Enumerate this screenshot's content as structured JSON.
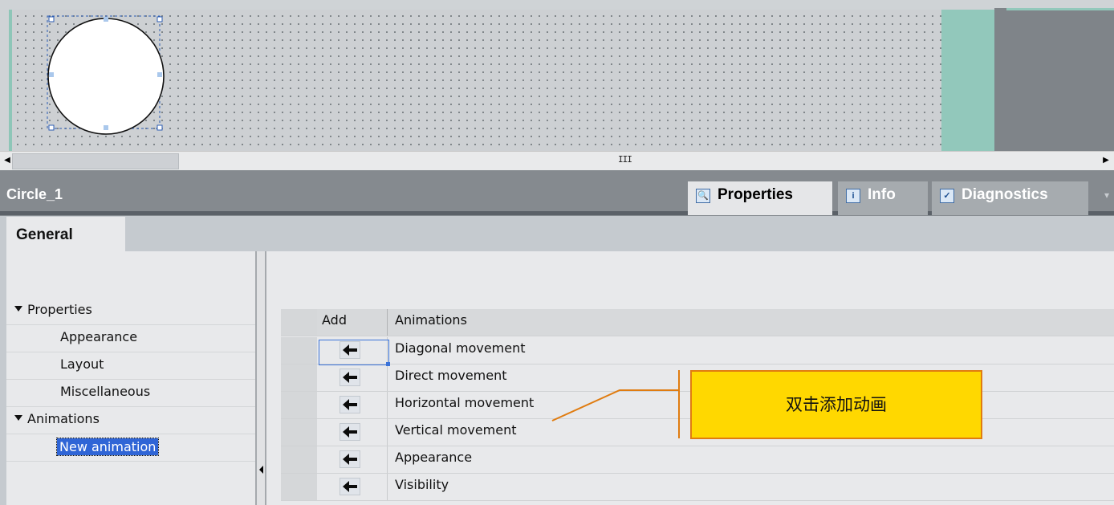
{
  "canvas": {
    "selected_object": "circle"
  },
  "scrollbar": {
    "left_arrow": "◀",
    "right_arrow": "▶",
    "grip": "III"
  },
  "inspector": {
    "title": "Circle_1",
    "tabs": [
      {
        "label": "Properties",
        "icon": "properties-icon",
        "active": true
      },
      {
        "label": "Info",
        "icon": "info-icon",
        "active": false
      },
      {
        "label": "Diagnostics",
        "icon": "diagnostics-icon",
        "active": false
      }
    ],
    "subtabs": [
      {
        "label": "General",
        "active": true
      }
    ]
  },
  "tree": {
    "sections": [
      {
        "label": "Properties",
        "expanded": true,
        "items": [
          "Appearance",
          "Layout",
          "Miscellaneous"
        ]
      },
      {
        "label": "Animations",
        "expanded": true,
        "items": [
          "New animation"
        ]
      }
    ],
    "selected": "New animation"
  },
  "animations_table": {
    "headers": {
      "add": "Add",
      "animations": "Animations"
    },
    "rows": [
      "Diagonal movement",
      "Direct movement",
      "Horizontal movement",
      "Vertical movement",
      "Appearance",
      "Visibility"
    ]
  },
  "callout": {
    "text": "双击添加动画"
  },
  "colors": {
    "accent_selection": "#2f65d6",
    "callout_fill": "#ffd800",
    "callout_border": "#e07c10",
    "header_bg": "#858a8f"
  }
}
